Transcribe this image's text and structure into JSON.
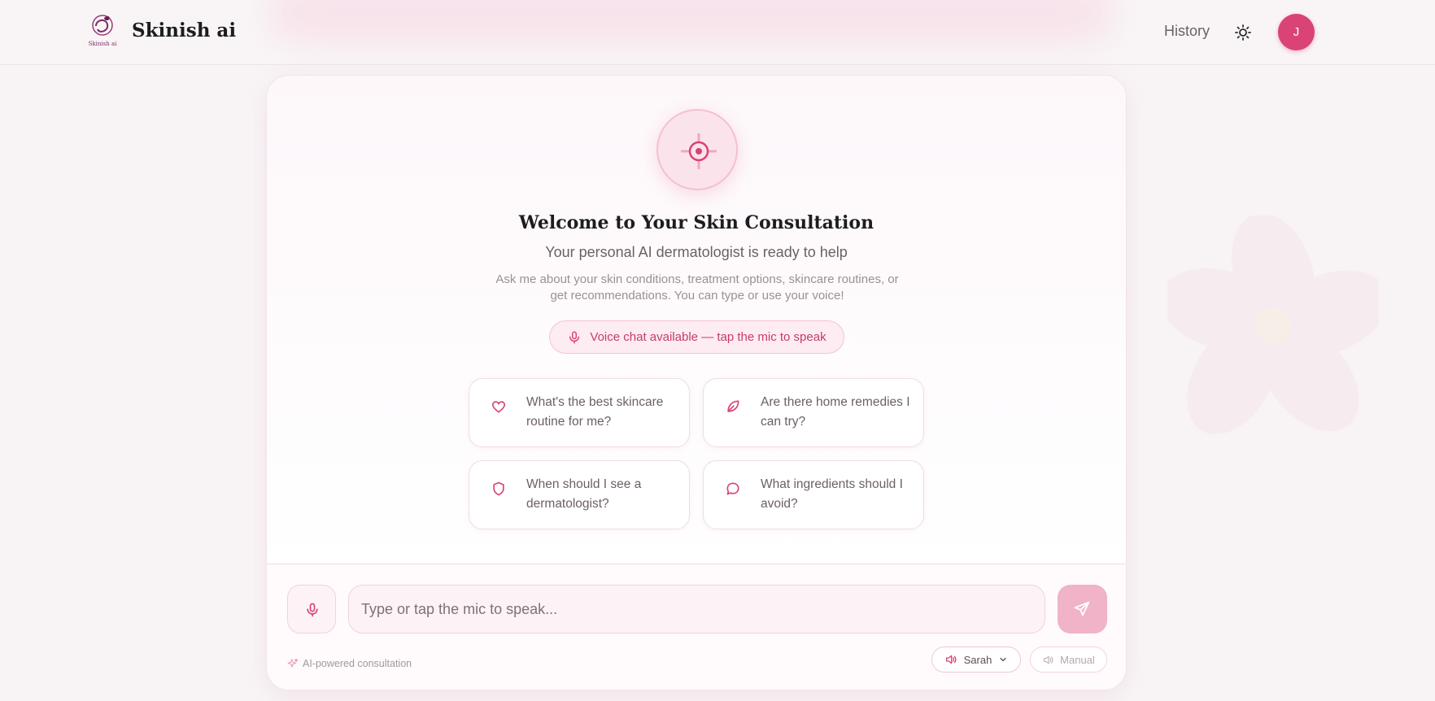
{
  "header": {
    "logo_text": "Skinish ai",
    "brand": "Skinish ai",
    "history_label": "History",
    "avatar_initial": "J"
  },
  "welcome": {
    "title": "Welcome to Your Skin Consultation",
    "subtitle": "Your personal AI dermatologist is ready to help",
    "description": "Ask me about your skin conditions, treatment options, skincare routines, or get recommendations. You can type or use your voice!",
    "voice_badge": "Voice chat available — tap the mic to speak"
  },
  "suggestions": [
    {
      "icon": "heart-icon",
      "text": "What's the best skincare routine for me?"
    },
    {
      "icon": "leaf-icon",
      "text": "Are there home remedies I can try?"
    },
    {
      "icon": "shield-icon",
      "text": "When should I see a dermatologist?"
    },
    {
      "icon": "chat-bubble-icon",
      "text": "What ingredients should I avoid?"
    }
  ],
  "composer": {
    "placeholder": "Type or tap the mic to speak...",
    "footnote": "AI-powered consultation",
    "voice_selected": "Sarah",
    "manual_label": "Manual"
  },
  "colors": {
    "accent": "#d94376",
    "accent_light": "#fdecf2",
    "send_disabled": "#f0b3c8"
  }
}
